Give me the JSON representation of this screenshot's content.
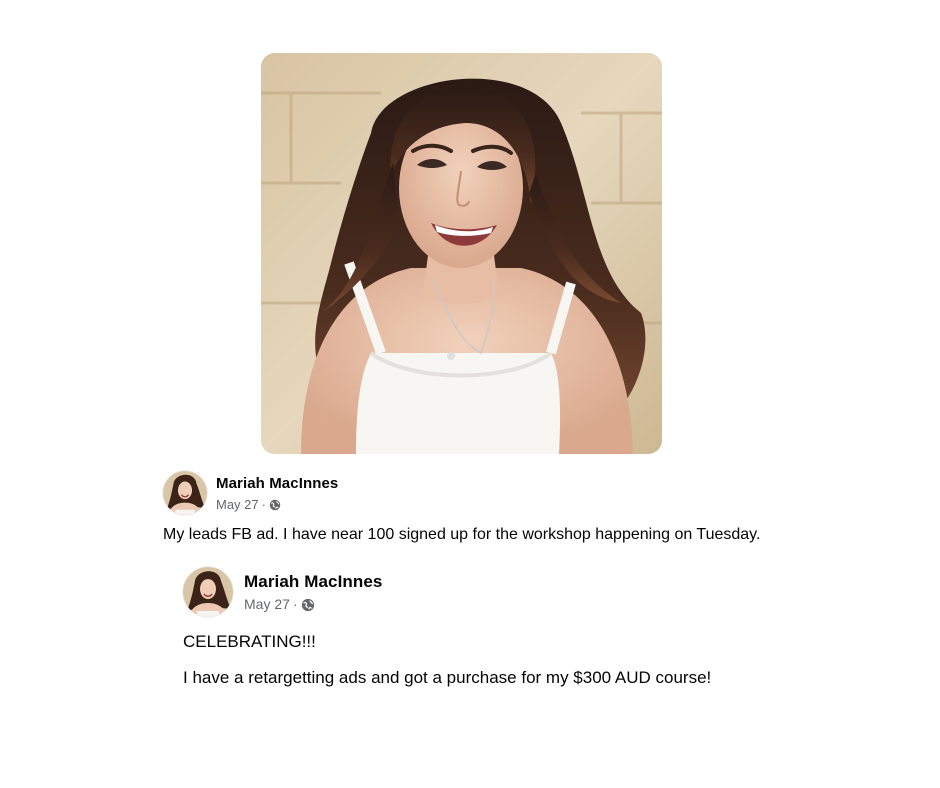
{
  "post": {
    "author": "Mariah MacInnes",
    "date": "May 27",
    "separator": "·",
    "privacy_icon": "globe-icon",
    "text": "My leads FB ad. I have near 100 signed up for the workshop happening on Tuesday."
  },
  "shared_post": {
    "author": "Mariah MacInnes",
    "date": "May 27",
    "separator": "·",
    "privacy_icon": "globe-icon",
    "line1": "CELEBRATING!!!",
    "line2": "I have a retargetting ads and got a purchase for my $300 AUD course!"
  },
  "colors": {
    "text_primary": "#050505",
    "text_secondary": "#65676b",
    "background": "#ffffff"
  }
}
